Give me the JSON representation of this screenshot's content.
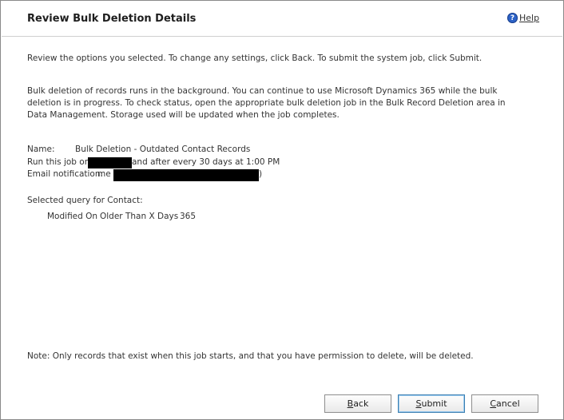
{
  "dialog": {
    "title": "Review Bulk Deletion Details",
    "help_label": "Help"
  },
  "intro": "Review the options you selected. To change any settings, click Back. To submit the system job, click Submit.",
  "info": "Bulk deletion of records runs in the background. You can continue to use Microsoft Dynamics 365 while the bulk deletion is in progress. To check status, open the appropriate bulk deletion job in the Bulk Record Deletion area in Data Management. Storage used will be updated when the job completes.",
  "summary": {
    "name_label": "Name:",
    "name_value": "Bulk Deletion - Outdated Contact Records",
    "run_prefix": "Run this job on",
    "run_suffix": "and after every 30 days at 1:00 PM",
    "email_label": "Email notification:",
    "email_value_prefix": "me (",
    "email_value_suffix": ")"
  },
  "query": {
    "heading": "Selected query for Contact:",
    "field": "Modified On",
    "operator": "Older Than X Days",
    "value": "365"
  },
  "note": "Note: Only records that exist when this job starts, and that you have permission to delete, will be deleted.",
  "buttons": {
    "back_first": "B",
    "back_rest": "ack",
    "submit_first": "S",
    "submit_rest": "ubmit",
    "cancel_first": "C",
    "cancel_rest": "ancel"
  }
}
